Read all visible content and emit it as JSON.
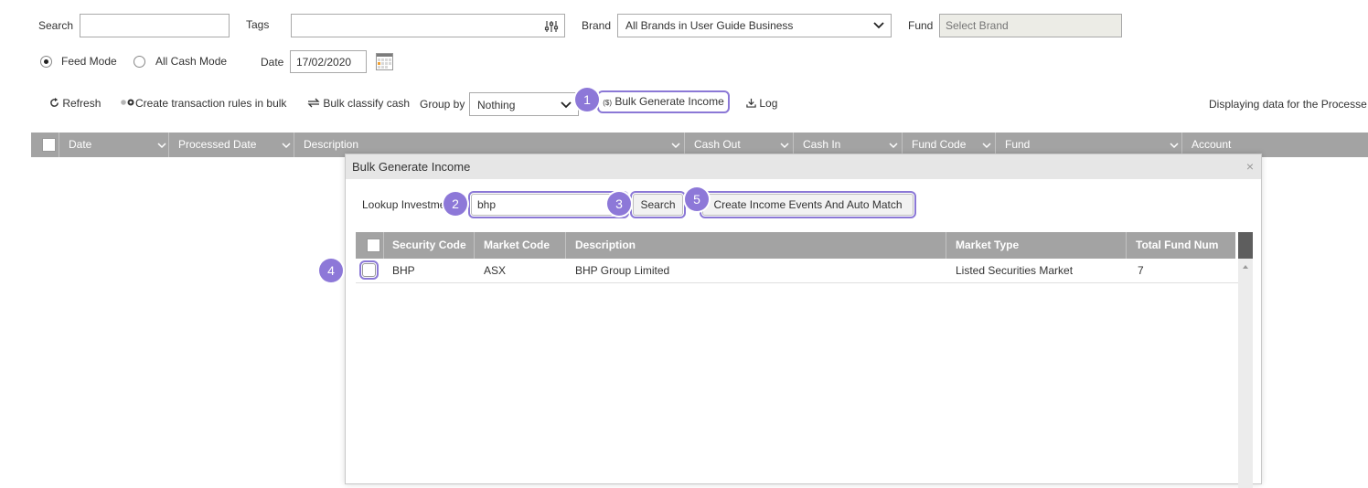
{
  "filters": {
    "search_label": "Search",
    "search_value": "",
    "tags_label": "Tags",
    "tags_value": "",
    "brand_label": "Brand",
    "brand_value": "All Brands in User Guide Business",
    "fund_label": "Fund",
    "fund_placeholder": "Select Brand",
    "modes": [
      {
        "label": "Feed Mode",
        "selected": true
      },
      {
        "label": "All Cash Mode",
        "selected": false
      }
    ],
    "date_label": "Date",
    "date_value": "17/02/2020"
  },
  "toolbar": {
    "refresh": "Refresh",
    "create_rules": "Create transaction rules in bulk",
    "bulk_classify": "Bulk classify cash",
    "group_by_label": "Group by",
    "group_by_value": "Nothing",
    "bulk_generate": "Bulk Generate Income",
    "bulk_generate_icon": "($)",
    "log": "Log",
    "status_text": "Displaying data for the Processe"
  },
  "grid": {
    "columns": [
      "Date",
      "Processed Date",
      "Description",
      "Cash Out",
      "Cash In",
      "Fund Code",
      "Fund",
      "Account"
    ]
  },
  "modal": {
    "title": "Bulk Generate Income",
    "close": "×",
    "lookup_label": "Lookup Investme",
    "lookup_value": "bhp",
    "search_button": "Search",
    "create_button": "Create Income Events And Auto Match",
    "columns": [
      "Security Code",
      "Market Code",
      "Description",
      "Market Type",
      "Total Fund Num"
    ],
    "rows": [
      {
        "security_code": "BHP",
        "market_code": "ASX",
        "description": "BHP Group Limited",
        "market_type": "Listed Securities Market",
        "total_fund_num": "7"
      }
    ]
  },
  "annotations": {
    "step1": "1",
    "step2": "2",
    "step3": "3",
    "step4": "4",
    "step5": "5",
    "accent_color": "#8d78d8"
  },
  "icons": {
    "tags_filter": "sliders-icon",
    "calendar": "calendar-icon",
    "refresh": "refresh-icon",
    "rules": "rules-toggle-icon",
    "classify": "arrows-exchange-icon",
    "log": "download-icon"
  }
}
